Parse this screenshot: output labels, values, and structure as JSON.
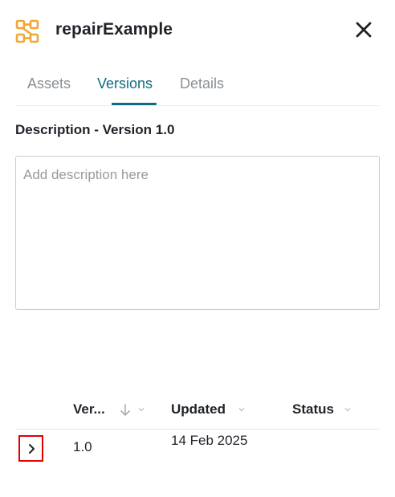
{
  "header": {
    "title": "repairExample",
    "icon": "network-nodes-icon",
    "accent_color": "#f0a830"
  },
  "tabs": [
    {
      "label": "Assets",
      "active": false
    },
    {
      "label": "Versions",
      "active": true
    },
    {
      "label": "Details",
      "active": false
    }
  ],
  "tab_active_color": "#0e6c82",
  "description": {
    "heading": "Description - Version 1.0",
    "value": "",
    "placeholder": "Add description here"
  },
  "table": {
    "columns": [
      {
        "label": "Ver...",
        "sort": "descending"
      },
      {
        "label": "Updated"
      },
      {
        "label": "Status"
      }
    ],
    "rows": [
      {
        "version": "1.0",
        "updated": "14 Feb 2025",
        "status": ""
      }
    ]
  },
  "highlight_color": "#e00000"
}
